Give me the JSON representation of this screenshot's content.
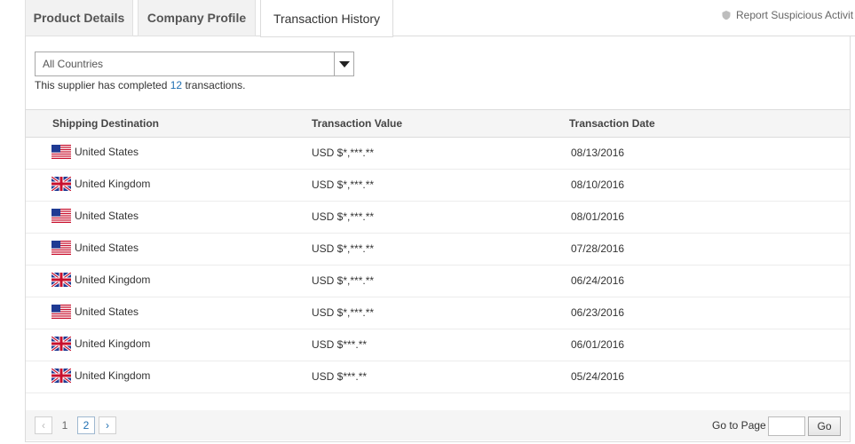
{
  "tabs": [
    {
      "label": "Product Details"
    },
    {
      "label": "Company Profile"
    },
    {
      "label": "Transaction History"
    }
  ],
  "report_link": "Report Suspicious Activit",
  "filter": {
    "selected": "All Countries"
  },
  "summary": {
    "prefix": "This supplier has completed ",
    "count": "12",
    "suffix": " transactions."
  },
  "table": {
    "headers": [
      "Shipping Destination",
      "Transaction Value",
      "Transaction Date"
    ],
    "rows": [
      {
        "country": "United States",
        "flag": "us-flag-icon",
        "value": "USD $*,***.**",
        "date": "08/13/2016"
      },
      {
        "country": "United Kingdom",
        "flag": "uk-flag-icon",
        "value": "USD $*,***.**",
        "date": "08/10/2016"
      },
      {
        "country": "United States",
        "flag": "us-flag-icon",
        "value": "USD $*,***.**",
        "date": "08/01/2016"
      },
      {
        "country": "United States",
        "flag": "us-flag-icon",
        "value": "USD $*,***.**",
        "date": "07/28/2016"
      },
      {
        "country": "United Kingdom",
        "flag": "uk-flag-icon",
        "value": "USD $*,***.**",
        "date": "06/24/2016"
      },
      {
        "country": "United States",
        "flag": "us-flag-icon",
        "value": "USD $*,***.**",
        "date": "06/23/2016"
      },
      {
        "country": "United Kingdom",
        "flag": "uk-flag-icon",
        "value": "USD $***.**",
        "date": "06/01/2016"
      },
      {
        "country": "United Kingdom",
        "flag": "uk-flag-icon",
        "value": "USD $***.**",
        "date": "05/24/2016"
      }
    ]
  },
  "pager": {
    "prev": "‹",
    "page1": "1",
    "page2": "2",
    "next": "›",
    "goto_label": "Go to Page",
    "goto_value": "",
    "go_button": "Go"
  },
  "colors": {
    "link": "#1f6fb2",
    "header_bg": "#f5f5f5"
  }
}
